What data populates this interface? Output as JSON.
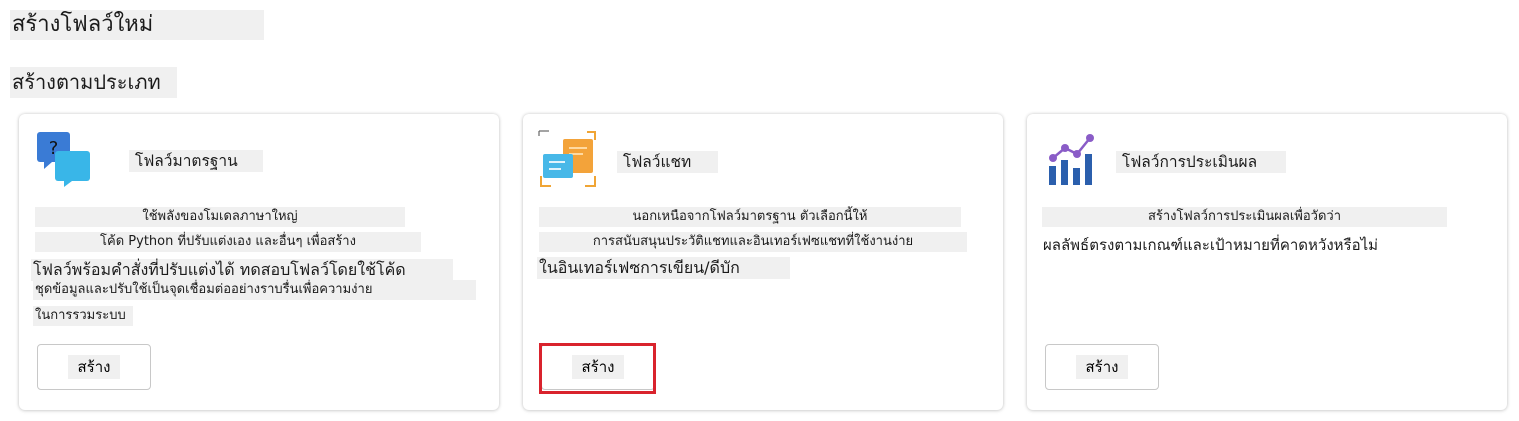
{
  "page": {
    "title": "สร้างโฟลว์ใหม่",
    "subtitle": "สร้างตามประเภท"
  },
  "cards": [
    {
      "name": "โฟลว์มาตรฐาน",
      "icon": "chat-question-icon",
      "description": [
        "ใช้พลังของโมเดลภาษาใหญ่",
        "โค้ด Python ที่ปรับแต่งเอง และอื่นๆ เพื่อสร้าง",
        "โฟลว์พร้อมคำสั่งที่ปรับแต่งได้ ทดสอบโฟลว์โดยใช้โค้ด",
        "ชุดข้อมูลและปรับใช้เป็นจุดเชื่อมต่ออย่างราบรื่นเพื่อความง่าย",
        "ในการรวมระบบ"
      ],
      "button_label": "สร้าง"
    },
    {
      "name": "โฟลว์แชท",
      "icon": "chat-documents-icon",
      "description": [
        "นอกเหนือจากโฟลว์มาตรฐาน ตัวเลือกนี้ให้",
        "การสนับสนุนประวัติแชทและอินเทอร์เฟซแชทที่ใช้งานง่าย",
        "ในอินเทอร์เฟซการเขียน/ดีบัก"
      ],
      "button_label": "สร้าง"
    },
    {
      "name": "โฟลว์การประเมินผล",
      "icon": "evaluation-chart-icon",
      "description": [
        "สร้างโฟลว์การประเมินผลเพื่อวัดว่า",
        "ผลลัพธ์ตรงตามเกณฑ์และเป้าหมายที่คาดหวังหรือไม่"
      ],
      "button_label": "สร้าง"
    }
  ],
  "colors": {
    "highlight_border": "#d9232d",
    "label_background": "#f0f0f0"
  }
}
